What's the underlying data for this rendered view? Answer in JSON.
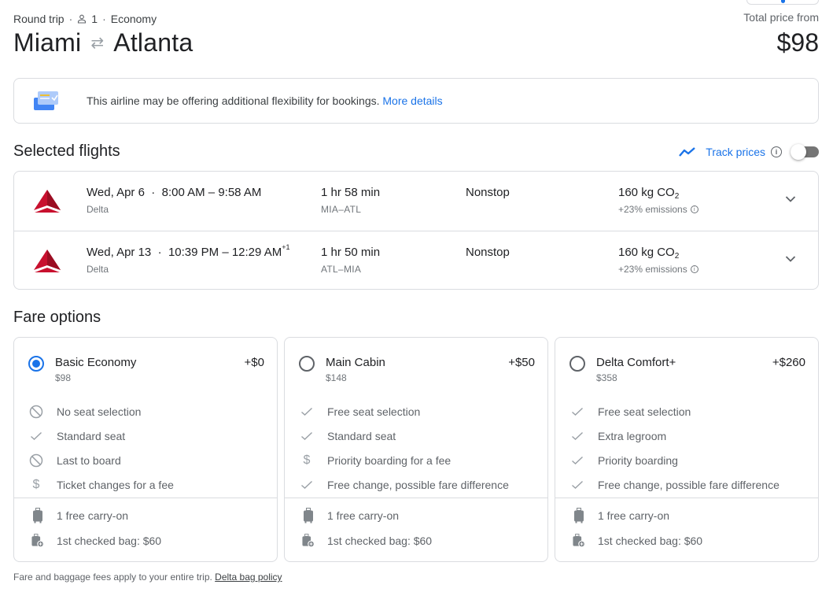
{
  "header": {
    "trip_type": "Round trip",
    "passengers": "1",
    "cabin": "Economy",
    "origin": "Miami",
    "destination": "Atlanta",
    "total_label": "Total price from",
    "total_price": "$98"
  },
  "notice": {
    "text": "This airline may be offering additional flexibility for bookings.",
    "link": "More details"
  },
  "selected_flights": {
    "title": "Selected flights",
    "track_label": "Track prices",
    "track_enabled": false,
    "flights": [
      {
        "date": "Wed, Apr 6",
        "times": "8:00 AM – 9:58 AM",
        "day_offset": "",
        "airline": "Delta",
        "duration": "1 hr 58 min",
        "route": "MIA–ATL",
        "stops": "Nonstop",
        "co2_value": "160 kg CO",
        "co2_sub": "2",
        "emissions": "+23% emissions"
      },
      {
        "date": "Wed, Apr 13",
        "times": "10:39 PM – 12:29 AM",
        "day_offset": "+1",
        "airline": "Delta",
        "duration": "1 hr 50 min",
        "route": "ATL–MIA",
        "stops": "Nonstop",
        "co2_value": "160 kg CO",
        "co2_sub": "2",
        "emissions": "+23% emissions"
      }
    ]
  },
  "fare_options": {
    "title": "Fare options",
    "cards": [
      {
        "name": "Basic Economy",
        "price": "$98",
        "delta": "+$0",
        "selected": true,
        "features": [
          {
            "icon": "no-icon",
            "text": "No seat selection"
          },
          {
            "icon": "check-icon",
            "text": "Standard seat"
          },
          {
            "icon": "no-icon",
            "text": "Last to board"
          },
          {
            "icon": "dollar-icon",
            "text": "Ticket changes for a fee"
          }
        ],
        "bags": [
          {
            "icon": "carry-on-icon",
            "text": "1 free carry-on"
          },
          {
            "icon": "checked-bag-icon",
            "text": "1st checked bag: $60"
          }
        ]
      },
      {
        "name": "Main Cabin",
        "price": "$148",
        "delta": "+$50",
        "selected": false,
        "features": [
          {
            "icon": "check-icon",
            "text": "Free seat selection"
          },
          {
            "icon": "check-icon",
            "text": "Standard seat"
          },
          {
            "icon": "dollar-icon",
            "text": "Priority boarding for a fee"
          },
          {
            "icon": "check-icon",
            "text": "Free change, possible fare difference"
          }
        ],
        "bags": [
          {
            "icon": "carry-on-icon",
            "text": "1 free carry-on"
          },
          {
            "icon": "checked-bag-icon",
            "text": "1st checked bag: $60"
          }
        ]
      },
      {
        "name": "Delta Comfort+",
        "price": "$358",
        "delta": "+$260",
        "selected": false,
        "features": [
          {
            "icon": "check-icon",
            "text": "Free seat selection"
          },
          {
            "icon": "check-icon",
            "text": "Extra legroom"
          },
          {
            "icon": "check-icon",
            "text": "Priority boarding"
          },
          {
            "icon": "check-icon",
            "text": "Free change, possible fare difference"
          }
        ],
        "bags": [
          {
            "icon": "carry-on-icon",
            "text": "1 free carry-on"
          },
          {
            "icon": "checked-bag-icon",
            "text": "1st checked bag: $60"
          }
        ]
      }
    ]
  },
  "footer": {
    "text": "Fare and baggage fees apply to your entire trip.",
    "link": "Delta bag policy"
  },
  "colors": {
    "accent": "#1a73e8",
    "delta_red": "#c8102e",
    "text_primary": "#202124",
    "text_secondary": "#70757a",
    "border": "#dadce0"
  }
}
